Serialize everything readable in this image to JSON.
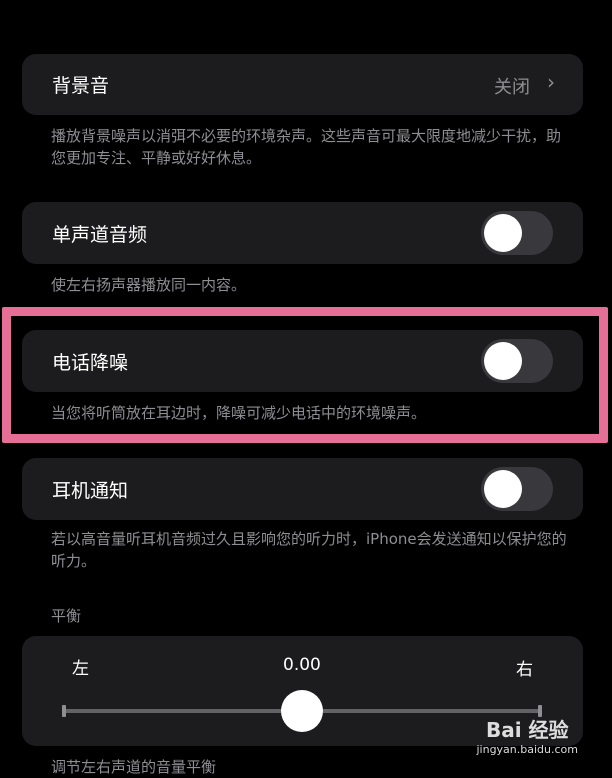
{
  "background_sounds": {
    "label": "背景音",
    "value": "关闭",
    "description": "播放背景噪声以消弭不必要的环境杂声。这些声音可最大限度地减少干扰，助您更加专注、平静或好好休息。"
  },
  "mono_audio": {
    "label": "单声道音频",
    "enabled": false,
    "description": "使左右扬声器播放同一内容。"
  },
  "phone_noise_cancellation": {
    "label": "电话降噪",
    "enabled": false,
    "description": "当您将听筒放在耳边时，降噪可减少电话中的环境噪声。"
  },
  "headphone_notifications": {
    "label": "耳机通知",
    "enabled": false,
    "description": "若以高音量听耳机音频过久且影响您的听力时，iPhone会发送通知以保护您的听力。"
  },
  "balance": {
    "header": "平衡",
    "left_label": "左",
    "right_label": "右",
    "value": "0.00",
    "level": 0.5,
    "description": "调节左右声道的音量平衡"
  },
  "watermark": {
    "brand": "Bai 经验",
    "url": "jingyan.baidu.com"
  },
  "colors": {
    "highlight": "#e56f96",
    "card": "#1c1c1e",
    "secondary_text": "#8e8e93"
  }
}
